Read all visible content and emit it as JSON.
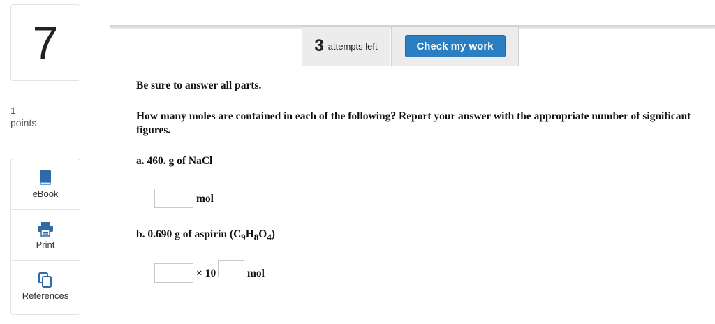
{
  "question": {
    "number": "7",
    "points_value": "1",
    "points_label": "points"
  },
  "tools": [
    {
      "label": "eBook",
      "icon": "book-icon"
    },
    {
      "label": "Print",
      "icon": "printer-icon"
    },
    {
      "label": "References",
      "icon": "copy-icon"
    }
  ],
  "header": {
    "attempts_number": "3",
    "attempts_label": "attempts left",
    "check_label": "Check my work"
  },
  "body": {
    "instruction": "Be sure to answer all parts.",
    "question_text": "How many moles are contained in each of the following? Report your answer with the appropriate number of significant figures.",
    "part_a": {
      "label": "a. 460. g of NaCl",
      "input_value": "",
      "unit": "mol"
    },
    "part_b": {
      "prefix": "b. 0.690 g of aspirin (C",
      "sub1": "9",
      "mid1": "H",
      "sub2": "8",
      "mid2": "O",
      "sub3": "4",
      "suffix": ")",
      "coefficient_value": "",
      "times_ten": "× 10",
      "exponent_value": "",
      "unit": "mol"
    }
  },
  "colors": {
    "accent": "#2b7ec1",
    "points_number": "#1f5f99"
  }
}
